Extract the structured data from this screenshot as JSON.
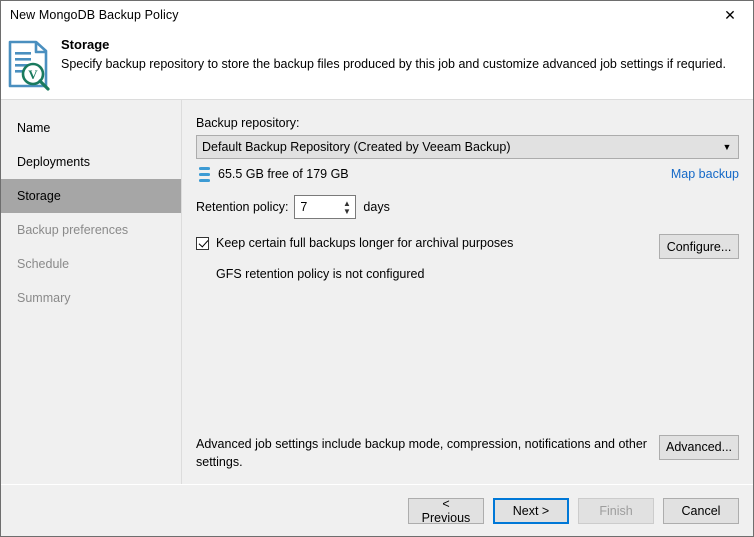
{
  "window": {
    "title": "New MongoDB Backup Policy",
    "close_icon": "close-icon"
  },
  "header": {
    "icon": "document-search-veeam-icon",
    "title": "Storage",
    "description": "Specify backup repository to store the backup files produced by this job and customize advanced job settings if requried."
  },
  "sidebar": {
    "items": [
      {
        "label": "Name",
        "state": "enabled"
      },
      {
        "label": "Deployments",
        "state": "enabled"
      },
      {
        "label": "Storage",
        "state": "active"
      },
      {
        "label": "Backup preferences",
        "state": "disabled"
      },
      {
        "label": "Schedule",
        "state": "disabled"
      },
      {
        "label": "Summary",
        "state": "disabled"
      }
    ]
  },
  "main": {
    "repository_label": "Backup repository:",
    "repository_value": "Default Backup Repository (Created by Veeam Backup)",
    "repository_arrow": "chevron-down-icon",
    "disk_icon": "storage-disk-icon",
    "free_space": "65.5 GB free of 179 GB",
    "map_backup_link": "Map backup",
    "retention_label": "Retention policy:",
    "retention_value": "7",
    "retention_units": "days",
    "gfs_checkbox_label": "Keep certain full backups longer for archival purposes",
    "gfs_checkbox_checked": true,
    "gfs_note": "GFS retention policy is not configured",
    "configure_button": "Configure...",
    "advanced_text": "Advanced job settings include backup mode, compression, notifications and other settings.",
    "advanced_button": "Advanced..."
  },
  "footer": {
    "previous": "< Previous",
    "next": "Next >",
    "finish": "Finish",
    "cancel": "Cancel"
  },
  "colors": {
    "accent_blue": "#0078d7",
    "link_blue": "#1569c7",
    "icon_blue": "#3d9bd4",
    "icon_teal": "#1a7a5e",
    "selection_gray": "#a6a6a6",
    "panel_bg": "#f0f0f0",
    "control_bg": "#e1e1e1"
  }
}
